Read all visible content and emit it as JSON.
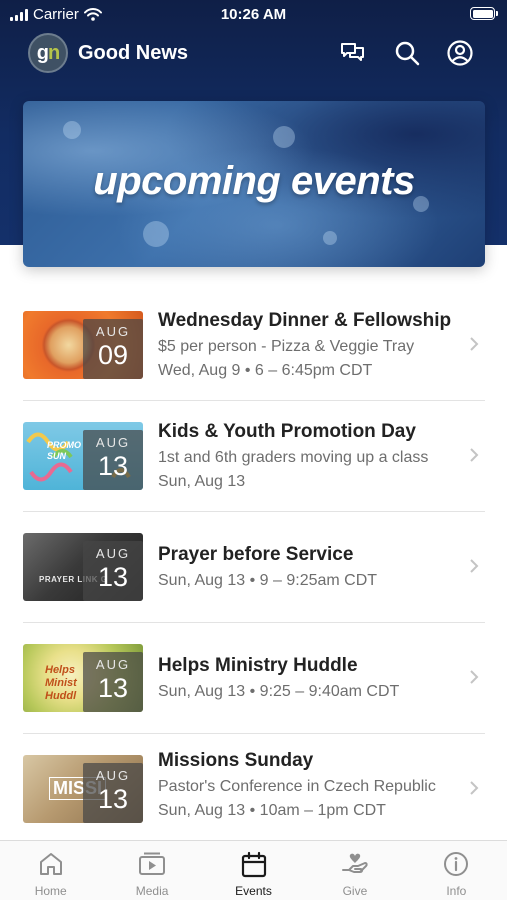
{
  "status_bar": {
    "carrier": "Carrier",
    "time": "10:26 AM"
  },
  "header": {
    "logo_text_g": "g",
    "logo_text_n": "n",
    "app_title": "Good News",
    "icons": [
      "chat-icon",
      "search-icon",
      "profile-icon"
    ]
  },
  "banner": {
    "title": "upcoming events"
  },
  "events": [
    {
      "title": "Wednesday Dinner & Fellowship",
      "line1": "$5 per person - Pizza & Veggie Tray",
      "line2": "Wed, Aug 9 • 6 – 6:45pm CDT",
      "month": "AUG",
      "day": "09",
      "thumb_label": ""
    },
    {
      "title": "Kids & Youth Promotion Day",
      "line1": "1st and 6th graders moving up a class",
      "line2": "Sun, Aug 13",
      "month": "AUG",
      "day": "13",
      "thumb_label": "PROMO SUN"
    },
    {
      "title": "Prayer before Service",
      "line1": "Sun, Aug 13 • 9 – 9:25am CDT",
      "line2": "",
      "month": "AUG",
      "day": "13",
      "thumb_label": "PRAYER LINK G"
    },
    {
      "title": "Helps Ministry Huddle",
      "line1": "Sun, Aug 13 • 9:25 – 9:40am CDT",
      "line2": "",
      "month": "AUG",
      "day": "13",
      "thumb_label": "Helps Minist Huddl"
    },
    {
      "title": "Missions Sunday",
      "line1": "Pastor's Conference in Czech Republic",
      "line2": "Sun, Aug 13 • 10am – 1pm CDT",
      "month": "AUG",
      "day": "13",
      "thumb_label": "MISSI"
    }
  ],
  "tabs": [
    {
      "label": "Home",
      "icon": "home-icon",
      "active": false
    },
    {
      "label": "Media",
      "icon": "media-icon",
      "active": false
    },
    {
      "label": "Events",
      "icon": "calendar-icon",
      "active": true
    },
    {
      "label": "Give",
      "icon": "give-icon",
      "active": false
    },
    {
      "label": "Info",
      "icon": "info-icon",
      "active": false
    }
  ],
  "colors": {
    "header": "#122c62",
    "active_tab": "#1a1a1a",
    "inactive_tab": "#8f8f8f"
  }
}
